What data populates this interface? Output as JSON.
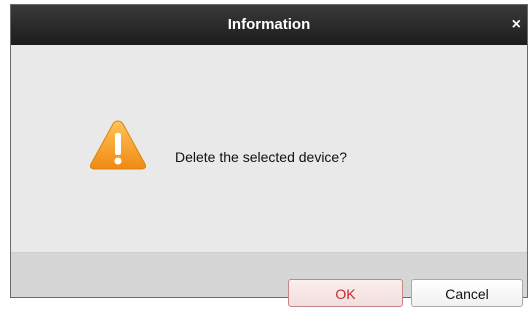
{
  "dialog": {
    "title": "Information",
    "close_symbol": "×",
    "message": "Delete the selected device?",
    "icon": "warning-icon",
    "buttons": {
      "ok_label": "OK",
      "cancel_label": "Cancel"
    }
  },
  "colors": {
    "titlebar": "#2a2a2a",
    "body": "#e9e9e9",
    "footer": "#d6d6d6",
    "warning": "#f5a623",
    "ok_text": "#c22c2c"
  }
}
